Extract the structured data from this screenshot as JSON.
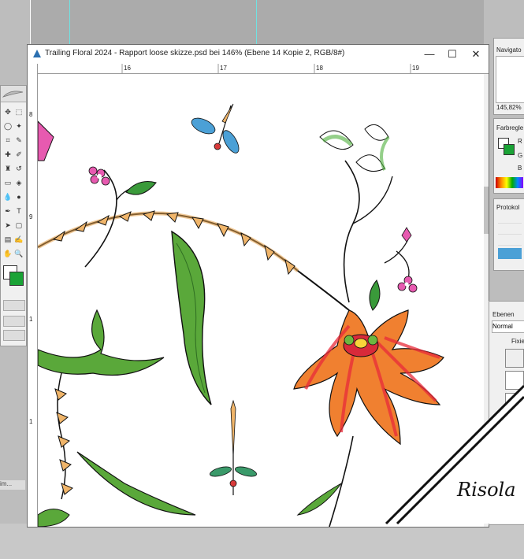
{
  "document": {
    "title": "Trailing Floral 2024 - Rapport loose skizze.psd bei 146% (Ebene 14 Kopie 2, RGB/8#)",
    "ruler_h": [
      "16",
      "17",
      "18",
      "19"
    ],
    "ruler_v": [
      "8",
      "9",
      "1",
      "1"
    ]
  },
  "window_controls": {
    "minimize": "—",
    "maximize": "☐",
    "close": "✕"
  },
  "navigator": {
    "title": "Navigato",
    "zoom": "145,82%"
  },
  "color_panel": {
    "title": "Farbregle",
    "r": "R",
    "g": "G",
    "b": "B"
  },
  "history": {
    "title": "Protokol"
  },
  "layers": {
    "title": "Ebenen",
    "blend": "Normal",
    "lock": "Fixie"
  },
  "left_partial": {
    "text": "im..."
  },
  "watermark": {
    "signature": "Risola"
  },
  "colors": {
    "foreground": "#1aa336",
    "accent": "#4ba0d6"
  }
}
